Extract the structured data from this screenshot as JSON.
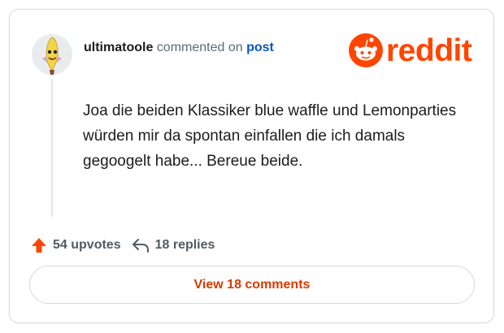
{
  "comment": {
    "username": "ultimatoole",
    "action_text": "commented on",
    "post_link_label": "post",
    "body": "Joa die beiden Klassiker blue waffle und Lemonparties würden mir da spontan einfallen die ich damals gegoogelt habe... Bereue beide."
  },
  "branding": {
    "logo_text": "reddit",
    "brand_color": "#ff4500"
  },
  "stats": {
    "upvotes_label": "54 upvotes",
    "replies_label": "18 replies"
  },
  "footer": {
    "view_comments_label": "View 18 comments"
  },
  "icons": {
    "upvote": "arrow-up-icon",
    "reply": "reply-arrow-icon",
    "logo": "reddit-snoo-icon"
  },
  "colors": {
    "upvote": "#ff4500",
    "link": "#0a56c2",
    "button_text": "#d93a00"
  }
}
